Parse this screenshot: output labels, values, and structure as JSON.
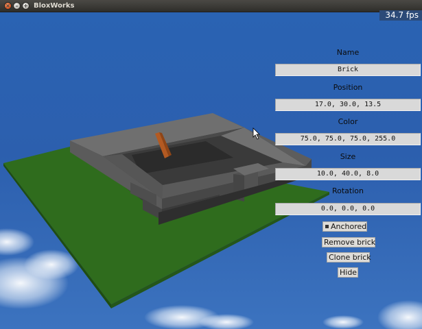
{
  "window": {
    "title": "BloxWorks"
  },
  "overlay": {
    "fps": "34.7 fps"
  },
  "panel": {
    "name_label": "Name",
    "name_value": "Brick",
    "position_label": "Position",
    "position_value": "17.0, 30.0, 13.5",
    "color_label": "Color",
    "color_value": "75.0, 75.0, 75.0, 255.0",
    "size_label": "Size",
    "size_value": "10.0, 40.0, 8.0",
    "rotation_label": "Rotation",
    "rotation_value": "0.0, 0.0, 0.0",
    "anchored_label": "Anchored",
    "anchored_checked": true,
    "remove_label": "Remove brick",
    "clone_label": "Clone brick",
    "hide_label": "Hide"
  },
  "colors": {
    "sky_top": "#1c4f9c",
    "sky_bottom": "#3a6fbd",
    "ground": "#2f6b1c",
    "brick_gray": "#4b4b4b",
    "selected_brick": "#c0652b"
  }
}
